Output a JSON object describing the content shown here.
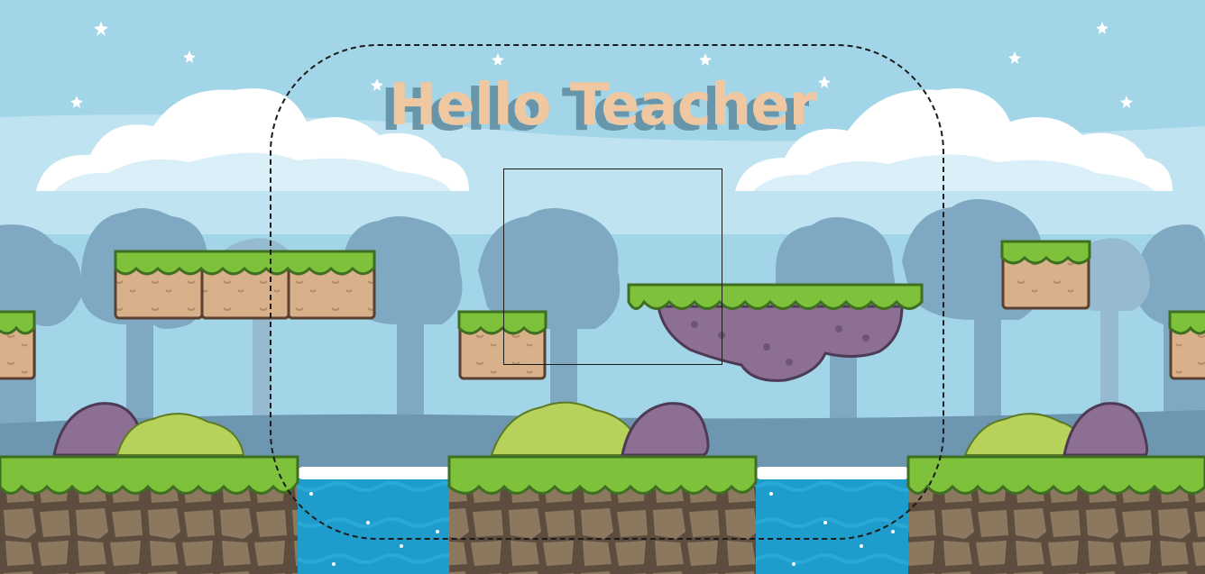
{
  "game": {
    "title": "Hello Teacher"
  },
  "colors": {
    "sky": "#a3d5e9",
    "title_text": "#efc7a1",
    "title_shadow": "#5d899e",
    "grass": "#7ec23c",
    "grass_dark": "#3f6f20",
    "dirt_block": "#d8b08a",
    "stone": "#8a7560",
    "water": "#1f9fcf",
    "purple_rock": "#8d6f93",
    "tree_silhouette": "#6d9ab5"
  },
  "scene": {
    "selections": [
      "rounded-dashed-frame",
      "square-frame"
    ]
  }
}
